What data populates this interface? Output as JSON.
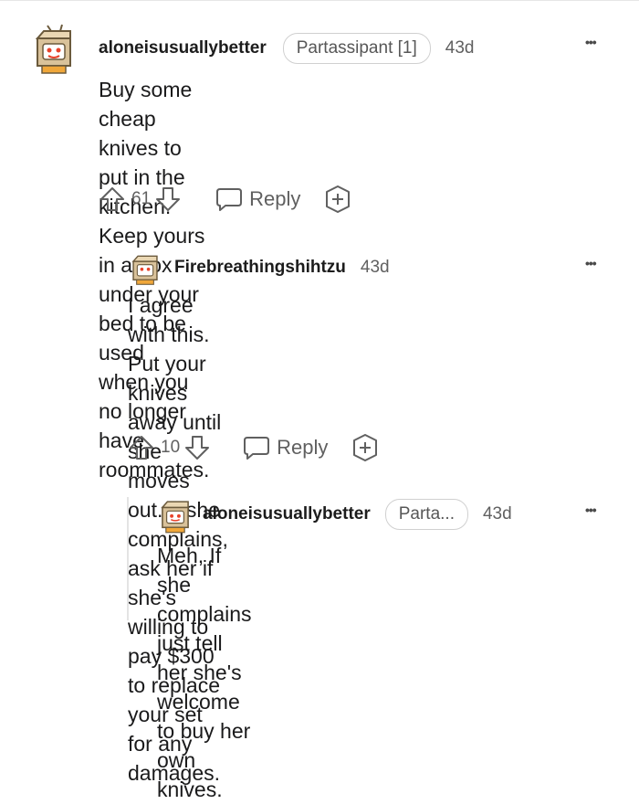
{
  "comments": [
    {
      "username": "aloneisusuallybetter",
      "flair": "Partassipant [1]",
      "time": "43d",
      "more": "•••",
      "lines": [
        "Buy some cheap knives to put in the kitchen.",
        "Keep yours in a box under your bed to be used",
        "when you no longer have roommates."
      ],
      "votes": "61",
      "reply_label": "Reply"
    },
    {
      "username": "Firebreathingshihtzu",
      "time": "43d",
      "more": "•••",
      "lines": [
        "I agree with this. Put your knives away until",
        "she moves out. If she complains, ask her if",
        "she's willing to pay $300 to replace your set",
        "for any damages."
      ],
      "votes": "10",
      "reply_label": "Reply"
    },
    {
      "username": "aloneisusuallybetter",
      "flair": "Parta...",
      "time": "43d",
      "more": "•••",
      "lines": [
        "Meh, If she complains just tell her she's",
        "welcome to buy her own knives."
      ]
    }
  ],
  "colors": {
    "text": "#1a1a1b",
    "meta": "#606060",
    "avatar_box": "#d9c29a",
    "avatar_face": "#e8432b"
  },
  "icons": [
    "robot-box-avatar",
    "upvote-arrow-icon",
    "downvote-arrow-icon",
    "reply-bubble-icon",
    "award-plus-icon",
    "more-dots-icon"
  ]
}
